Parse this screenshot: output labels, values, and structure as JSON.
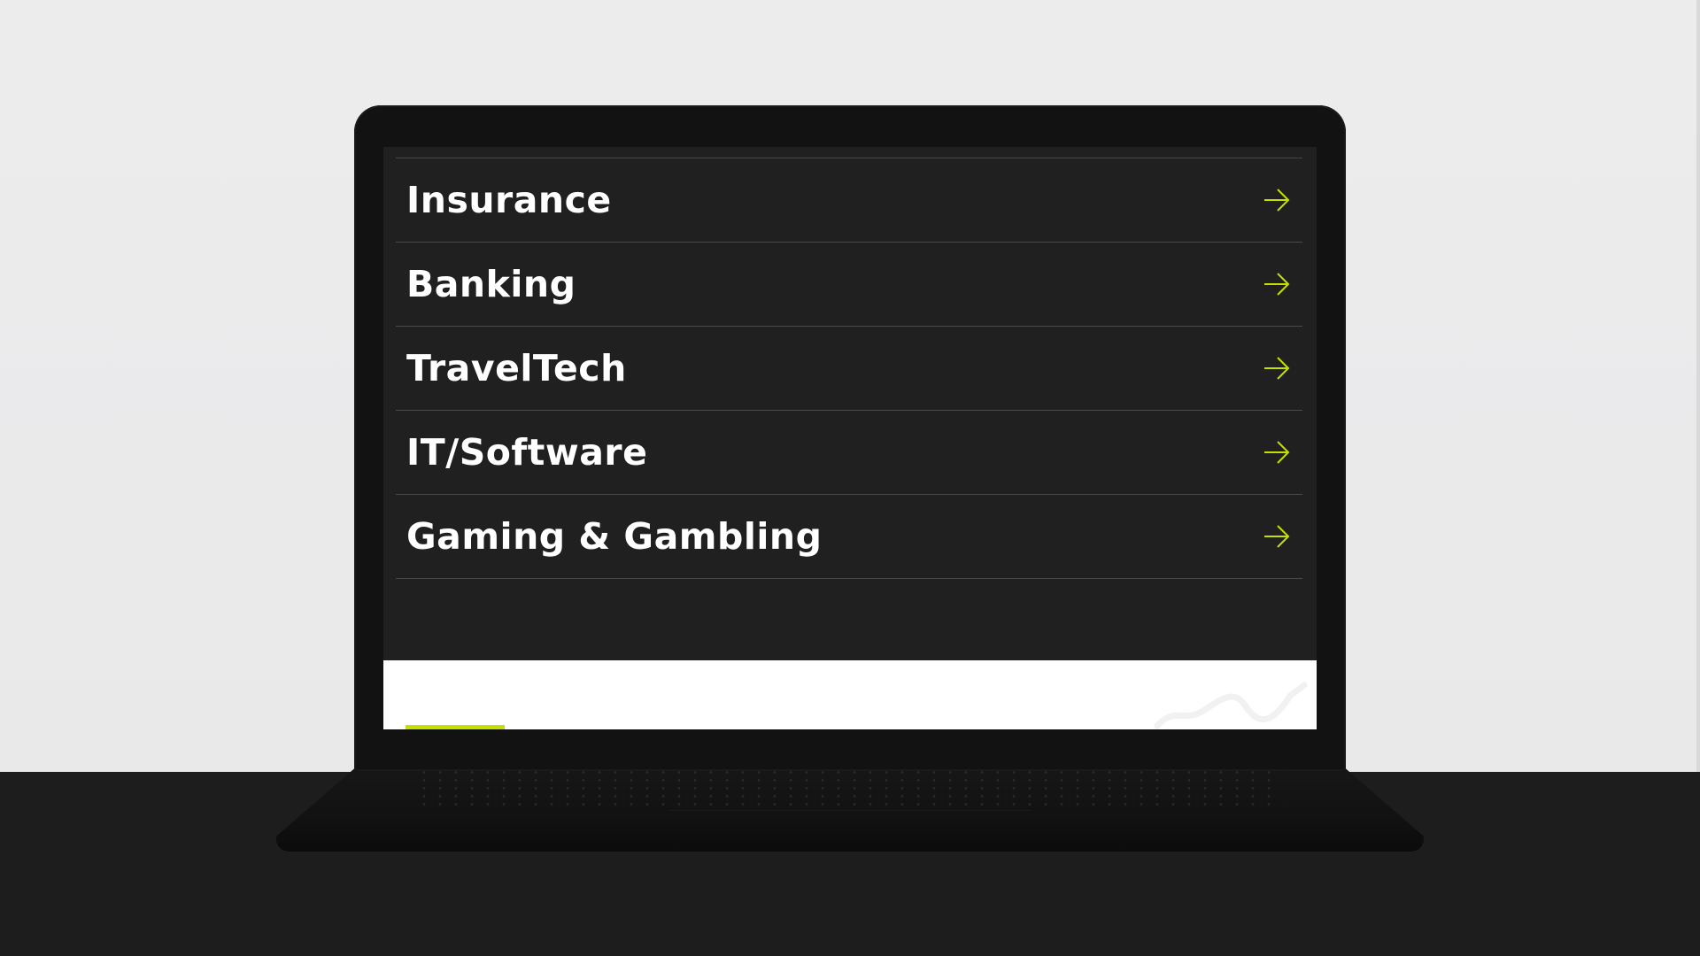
{
  "scene": {
    "background_color": "#ebebec",
    "desk_color": "#1d1d1e"
  },
  "screen": {
    "background_color": "#202021",
    "accent_color": "#c5e000",
    "menu": {
      "items": [
        {
          "label": "Insurance",
          "icon": "arrow-right-icon"
        },
        {
          "label": "Banking",
          "icon": "arrow-right-icon"
        },
        {
          "label": "TravelTech",
          "icon": "arrow-right-icon"
        },
        {
          "label": "IT/Software",
          "icon": "arrow-right-icon"
        },
        {
          "label": "Gaming & Gambling",
          "icon": "arrow-right-icon"
        }
      ]
    }
  }
}
